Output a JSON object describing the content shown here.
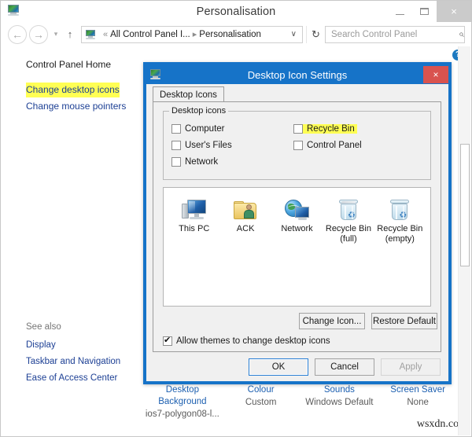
{
  "window": {
    "title": "Personalisation",
    "app_icon": "personalisation-icon",
    "controls": {
      "minimize": "minimize-icon",
      "maximize": "maximize-icon",
      "close": "×"
    }
  },
  "toolbar": {
    "back": "←",
    "forward": "→",
    "recent": "▾",
    "up": "↑",
    "breadcrumb": {
      "overflow": "«",
      "parent": "All Control Panel I...",
      "separator": "▸",
      "current": "Personalisation",
      "chevron": "∨"
    },
    "refresh": "↻",
    "search": {
      "placeholder": "Search Control Panel",
      "icon": "⌕"
    },
    "help": "?"
  },
  "left_pane": {
    "items": [
      {
        "label": "Control Panel Home",
        "highlighted": false
      },
      {
        "label": "Change desktop icons",
        "highlighted": true
      },
      {
        "label": "Change mouse pointers",
        "highlighted": false
      }
    ],
    "see_also": {
      "label": "See also",
      "items": [
        {
          "label": "Display"
        },
        {
          "label": "Taskbar and Navigation"
        },
        {
          "label": "Ease of Access Center"
        }
      ]
    }
  },
  "theme_strip": [
    {
      "title": "Desktop Background",
      "value": "ios7-polygon08-l..."
    },
    {
      "title": "Colour",
      "value": "Custom"
    },
    {
      "title": "Sounds",
      "value": "Windows Default"
    },
    {
      "title": "Screen Saver",
      "value": "None"
    }
  ],
  "watermark": "wsxdn.com",
  "dialog": {
    "title": "Desktop Icon Settings",
    "app_icon": "personalisation-icon",
    "close": "×",
    "tab": "Desktop Icons",
    "group_legend": "Desktop icons",
    "checkboxes": [
      {
        "label": "Computer",
        "checked": false,
        "highlighted": false
      },
      {
        "label": "User's Files",
        "checked": false,
        "highlighted": false
      },
      {
        "label": "Network",
        "checked": false,
        "highlighted": false
      },
      {
        "label": "Recycle Bin",
        "checked": false,
        "highlighted": true
      },
      {
        "label": "Control Panel",
        "checked": false,
        "highlighted": false
      }
    ],
    "icon_previews": [
      {
        "label": "This PC",
        "sublabel": "",
        "icon": "computer-icon"
      },
      {
        "label": "ACK",
        "sublabel": "",
        "icon": "user-folder-icon"
      },
      {
        "label": "Network",
        "sublabel": "",
        "icon": "network-icon"
      },
      {
        "label": "Recycle Bin",
        "sublabel": "(full)",
        "icon": "recycle-bin-full-icon"
      },
      {
        "label": "Recycle Bin",
        "sublabel": "(empty)",
        "icon": "recycle-bin-empty-icon"
      }
    ],
    "change_icon_label": "Change Icon...",
    "restore_default_label": "Restore Default",
    "allow_themes": {
      "label": "Allow themes to change desktop icons",
      "checked": true
    },
    "ok_label": "OK",
    "cancel_label": "Cancel",
    "apply_label": "Apply"
  },
  "colors": {
    "accent_blue": "#1673c8",
    "link_blue": "#1c3f94",
    "highlight_yellow": "#ffff54",
    "close_red": "#d9534f"
  }
}
